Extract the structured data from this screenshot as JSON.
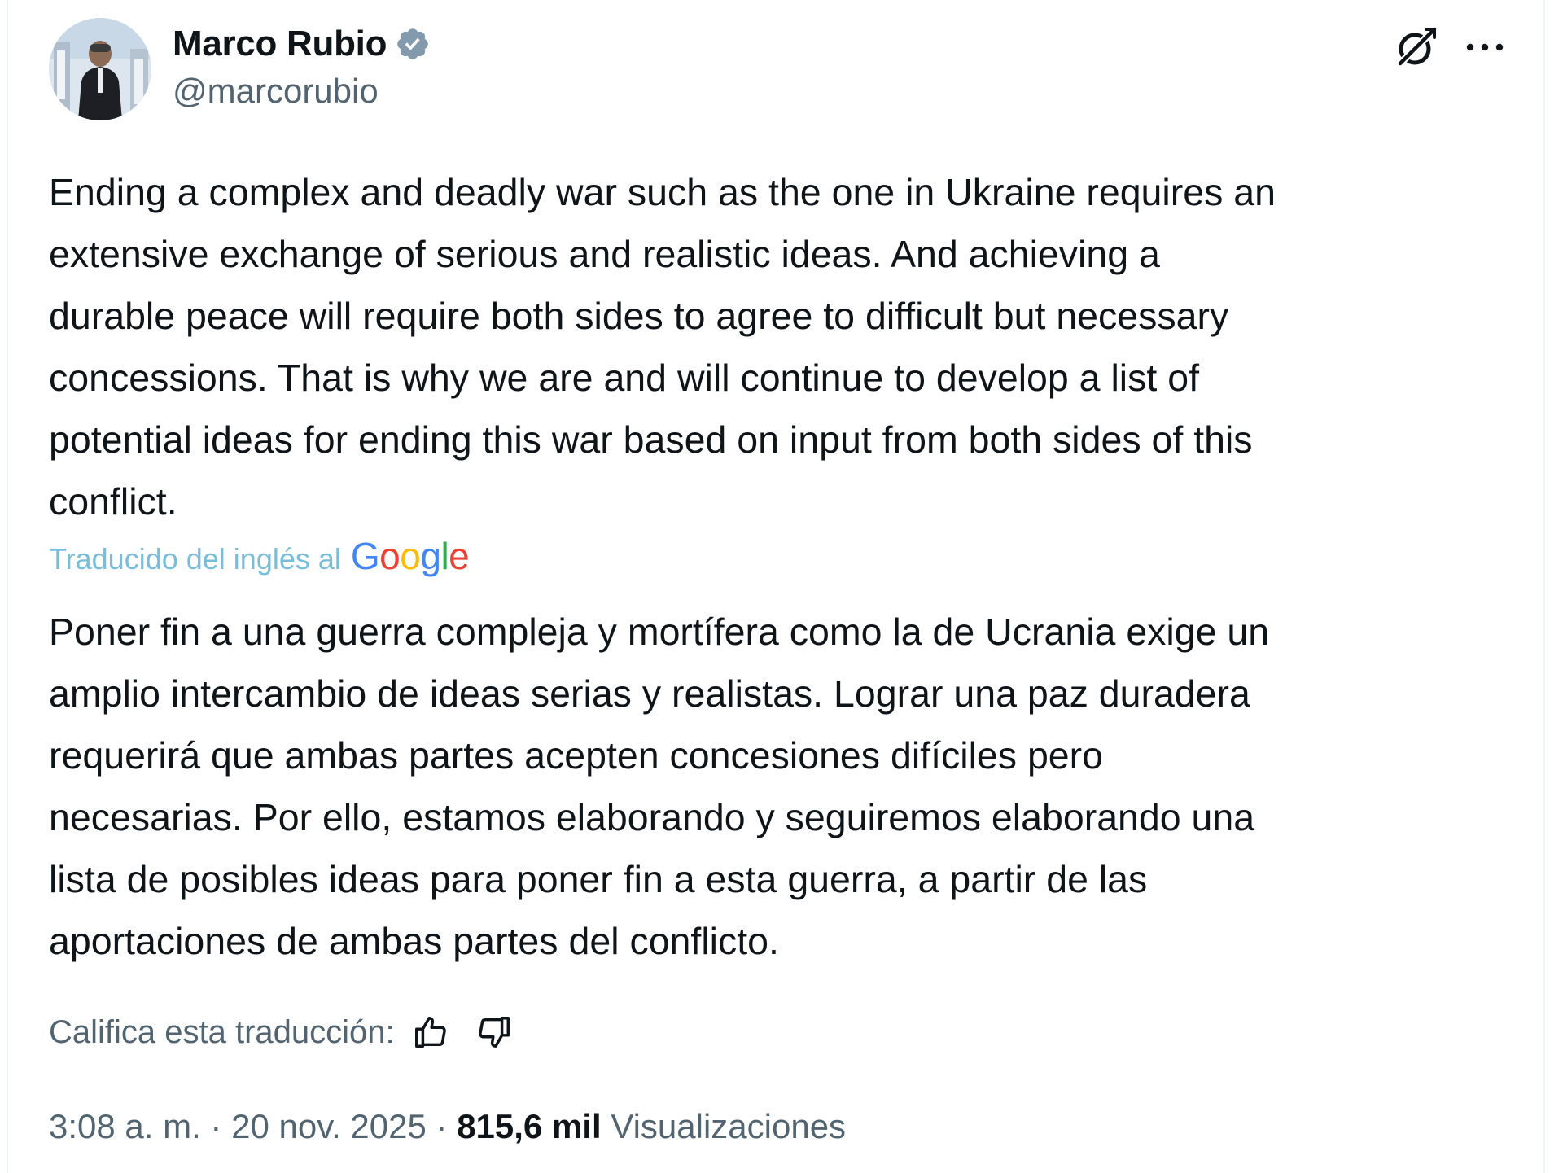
{
  "author": {
    "display_name": "Marco Rubio",
    "handle": "@marcorubio",
    "verified": true,
    "verified_color": "#829aab"
  },
  "actions": {
    "grok_icon": "grok-icon",
    "more_icon": "more-icon"
  },
  "tweet": {
    "text": "Ending a complex and deadly war such as the one in Ukraine requires an\nextensive exchange of serious and realistic ideas. And achieving a\ndurable peace will require both sides to agree to difficult but necessary\nconcessions. That is why we are and will continue to develop a list of\npotential ideas for ending this war based on input from both sides of this\nconflict."
  },
  "translation": {
    "label": "Traducido del inglés al",
    "provider": "Google",
    "label_color": "#78bdd9",
    "text": "Poner fin a una guerra compleja y mortífera como la de Ucrania exige un\namplio intercambio de ideas serias y realistas. Lograr una paz duradera\nrequerirá que ambas partes acepten concesiones difíciles pero\nnecesarias. Por ello, estamos elaborando y seguiremos elaborando una\nlista de posibles ideas para poner fin a esta guerra, a partir de las\naportaciones de ambas partes del conflicto.",
    "rate_label": "Califica esta traducción:"
  },
  "meta": {
    "time": "3:08 a. m.",
    "separator": " · ",
    "date": "20 nov. 2025",
    "views_count": "815,6 mil",
    "views_label": "Visualizaciones"
  }
}
